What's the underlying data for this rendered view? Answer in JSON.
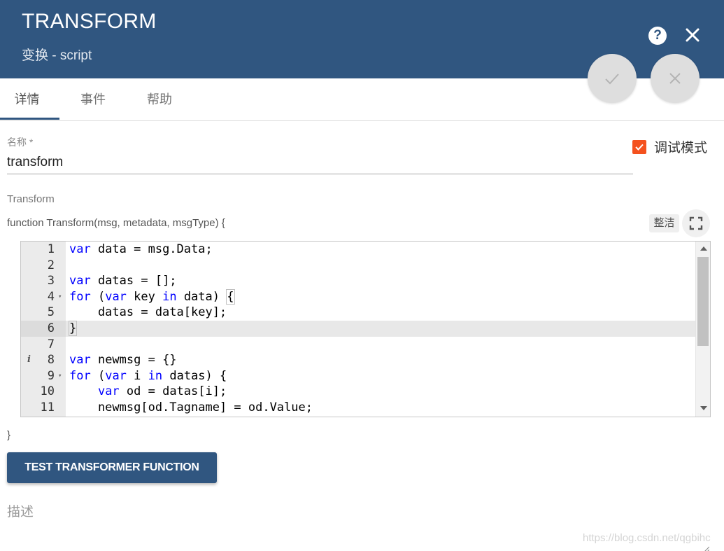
{
  "header": {
    "title": "TRANSFORM",
    "subtitle": "变换 - script",
    "help_icon": "help-circle-icon",
    "close_icon": "close-icon"
  },
  "actions": {
    "apply_icon": "check-icon",
    "cancel_icon": "close-icon"
  },
  "tabs": [
    {
      "label": "详情",
      "active": true
    },
    {
      "label": "事件",
      "active": false
    },
    {
      "label": "帮助",
      "active": false
    }
  ],
  "form": {
    "name_label": "名称 *",
    "name_value": "transform",
    "debug_label": "调试模式",
    "debug_checked": true,
    "transform_label": "Transform",
    "function_signature": "function Transform(msg, metadata, msgType) {",
    "tidy_label": "整洁",
    "fullscreen_icon": "fullscreen-icon",
    "closing_brace": "}",
    "test_button_label": "TEST TRANSFORMER FUNCTION",
    "description_label": "描述"
  },
  "editor": {
    "active_line": 6,
    "lines": [
      {
        "n": "1",
        "text": "var data = msg.Data;"
      },
      {
        "n": "2",
        "text": ""
      },
      {
        "n": "3",
        "text": "var datas = [];"
      },
      {
        "n": "4",
        "text": "for (var key in data) {"
      },
      {
        "n": "5",
        "text": "    datas = data[key];"
      },
      {
        "n": "6",
        "text": "}"
      },
      {
        "n": "7",
        "text": ""
      },
      {
        "n": "8",
        "text": "var newmsg = {}"
      },
      {
        "n": "9",
        "text": "for (var i in datas) {"
      },
      {
        "n": "10",
        "text": "    var od = datas[i];"
      },
      {
        "n": "11",
        "text": "    newmsg[od.Tagname] = od.Value;"
      }
    ]
  },
  "watermark": "https://blog.csdn.net/qgbihc",
  "colors": {
    "header": "#305680",
    "accent_checkbox": "#f4511e",
    "keyword": "#0000ff"
  }
}
